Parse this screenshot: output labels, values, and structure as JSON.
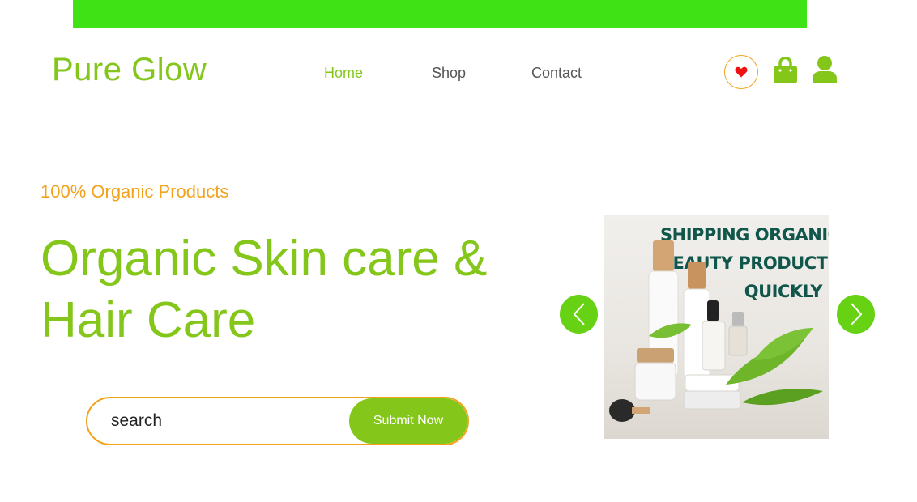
{
  "brand": {
    "name": "Pure Glow",
    "accent": "#84c71a",
    "secondary": "#f2a21b",
    "topbar_color": "#3fe315"
  },
  "nav": {
    "items": [
      {
        "label": "Home",
        "active": true
      },
      {
        "label": "Shop",
        "active": false
      },
      {
        "label": "Contact",
        "active": false
      }
    ]
  },
  "header_icons": [
    "heart-icon",
    "shopping-bag-icon",
    "user-icon"
  ],
  "hero": {
    "kicker": "100% Organic Products",
    "headline_line1": "Organic Skin care &",
    "headline_line2": "Hair Care"
  },
  "search": {
    "placeholder": "search",
    "button_label": "Submit Now"
  },
  "carousel": {
    "caption_line1": "SHIPPING ORGANIC",
    "caption_line2": "BEAUTY PRODUCTS",
    "caption_line3": "QUICKLY",
    "prev_icon": "chevron-left-icon",
    "next_icon": "chevron-right-icon"
  }
}
